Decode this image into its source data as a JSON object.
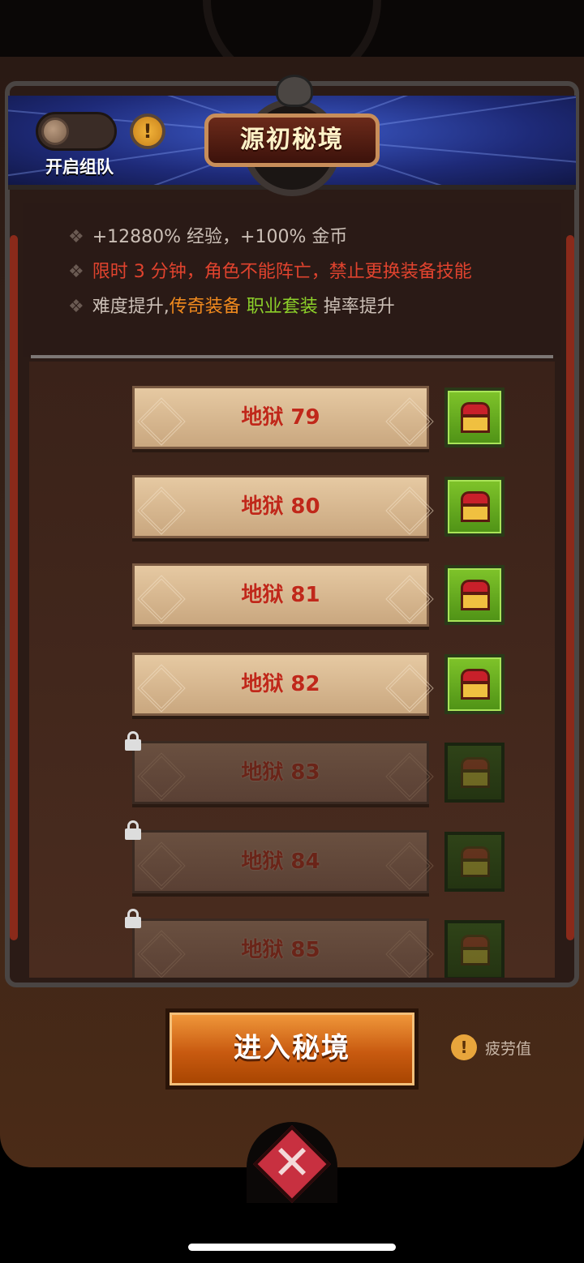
{
  "header": {
    "title": "源初秘境",
    "team_toggle_label": "开启组队",
    "info_icon": "!"
  },
  "rules": [
    {
      "parts": [
        {
          "text": "+12880% 经验，+100% 金币",
          "color": "#cbbfb6"
        }
      ]
    },
    {
      "parts": [
        {
          "text": "限时 3 分钟，角色不能阵亡，禁止更换装备技能",
          "color": "#e0432e"
        }
      ]
    },
    {
      "parts": [
        {
          "text": "难度提升,",
          "color": "#cbbfb6"
        },
        {
          "text": "传奇装备",
          "color": "#f08a1e"
        },
        {
          "text": " 职业套装",
          "color": "#8ccf2a"
        },
        {
          "text": " 掉率提升",
          "color": "#cbbfb6"
        }
      ]
    }
  ],
  "levels": [
    {
      "label": "地狱 79",
      "locked": false
    },
    {
      "label": "地狱 80",
      "locked": false
    },
    {
      "label": "地狱 81",
      "locked": false
    },
    {
      "label": "地狱 82",
      "locked": false
    },
    {
      "label": "地狱 83",
      "locked": true
    },
    {
      "label": "地狱 84",
      "locked": true
    },
    {
      "label": "地狱 85",
      "locked": true
    }
  ],
  "footer": {
    "enter_label": "进入秘境",
    "fatigue_label": "疲劳值",
    "fatigue_icon": "!"
  },
  "icons": {
    "chest": "treasure-chest-icon",
    "lock": "lock-icon",
    "close": "close-icon",
    "info": "info-icon"
  },
  "colors": {
    "accent_orange": "#c85a10",
    "chest_green": "#7fc42a",
    "level_red": "#c0281a"
  }
}
